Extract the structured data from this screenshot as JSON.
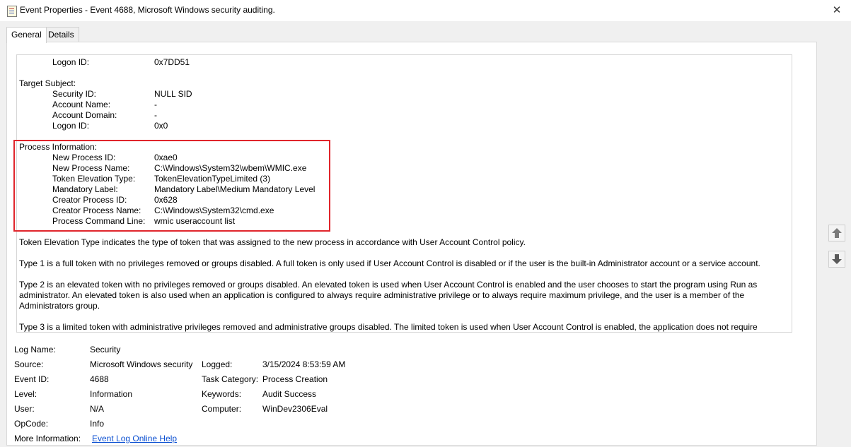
{
  "window": {
    "title": "Event Properties - Event 4688, Microsoft Windows security auditing.",
    "close_glyph": "✕"
  },
  "tabs": [
    {
      "label": "General",
      "active": true
    },
    {
      "label": "Details",
      "active": false
    }
  ],
  "description": {
    "top_logon": {
      "label": "Logon ID:",
      "value": "0x7DD51"
    },
    "target_subject_header": "Target Subject:",
    "target_subject": [
      {
        "label": "Security ID:",
        "value": "NULL SID"
      },
      {
        "label": "Account Name:",
        "value": "-"
      },
      {
        "label": "Account Domain:",
        "value": "-"
      },
      {
        "label": "Logon ID:",
        "value": "0x0"
      }
    ],
    "process_info_header": "Process Information:",
    "process_info": [
      {
        "label": "New Process ID:",
        "value": "0xae0"
      },
      {
        "label": "New Process Name:",
        "value": "C:\\Windows\\System32\\wbem\\WMIC.exe"
      },
      {
        "label": "Token Elevation Type:",
        "value": "TokenElevationTypeLimited (3)"
      },
      {
        "label": "Mandatory Label:",
        "value": "Mandatory Label\\Medium Mandatory Level"
      },
      {
        "label": "Creator Process ID:",
        "value": "0x628"
      },
      {
        "label": "Creator Process Name:",
        "value": "C:\\Windows\\System32\\cmd.exe"
      },
      {
        "label": "Process Command Line:",
        "value": "wmic  useraccount list"
      }
    ],
    "para_token": "Token Elevation Type indicates the type of token that was assigned to the new process in accordance with User Account Control policy.",
    "para_type1": "Type 1 is a full token with no privileges removed or groups disabled.  A full token is only used if User Account Control is disabled or if the user is the built-in Administrator account or a service account.",
    "para_type2": "Type 2 is an elevated token with no privileges removed or groups disabled.  An elevated token is used when User Account Control is enabled and the user chooses to start the program using Run as administrator.  An elevated token is also used when an application is configured to always require administrative privilege or to always require maximum privilege, and the user is a member of the Administrators group.",
    "para_type3": "Type 3 is a limited token with administrative privileges removed and administrative groups disabled.  The limited token is used when User Account Control is enabled, the application does not require"
  },
  "meta": {
    "log_name_label": "Log Name:",
    "log_name": "Security",
    "source_label": "Source:",
    "source": "Microsoft Windows security",
    "logged_label": "Logged:",
    "logged": "3/15/2024 8:53:59 AM",
    "event_id_label": "Event ID:",
    "event_id": "4688",
    "task_category_label": "Task Category:",
    "task_category": "Process Creation",
    "level_label": "Level:",
    "level": "Information",
    "keywords_label": "Keywords:",
    "keywords": "Audit Success",
    "user_label": "User:",
    "user": "N/A",
    "computer_label": "Computer:",
    "computer": "WinDev2306Eval",
    "opcode_label": "OpCode:",
    "opcode": "Info",
    "more_info_label": "More Information:",
    "more_info_link": "Event Log Online Help"
  },
  "colors": {
    "highlight": "#e0252b",
    "link": "#0b4fd1"
  },
  "icons": [
    "event-icon",
    "close-icon",
    "arrow-up-icon",
    "arrow-down-icon"
  ]
}
